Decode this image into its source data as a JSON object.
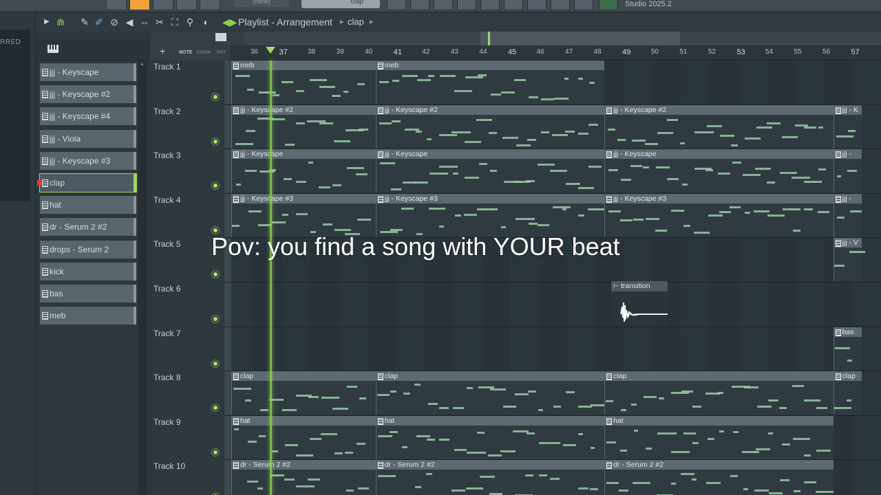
{
  "app": {
    "studio_label": "Studio 2025.2",
    "pattern_selector": "clap",
    "none_selector": "(none)",
    "sidebar_label": "RRED"
  },
  "playlist": {
    "title": "Playlist - Arrangement",
    "breadcrumb": "clap",
    "header_labels": [
      "NOTE",
      "CHAN",
      "PAT"
    ]
  },
  "patterns": [
    {
      "label": "jjj - Keyscape",
      "selected": false
    },
    {
      "label": "jjj - Keyscape #2",
      "selected": false
    },
    {
      "label": "jjj - Keyscape #4",
      "selected": false
    },
    {
      "label": "jjj - Viola",
      "selected": false
    },
    {
      "label": "jjj - Keyscape #3",
      "selected": false
    },
    {
      "label": "clap",
      "selected": true
    },
    {
      "label": "hat",
      "selected": false
    },
    {
      "label": "dr - Serum 2 #2",
      "selected": false
    },
    {
      "label": "drops - Serum 2",
      "selected": false
    },
    {
      "label": "kick",
      "selected": false
    },
    {
      "label": "bas",
      "selected": false
    },
    {
      "label": "meb",
      "selected": false
    }
  ],
  "ruler": [
    "36",
    "37",
    "38",
    "39",
    "40",
    "41",
    "42",
    "43",
    "44",
    "45",
    "46",
    "47",
    "48",
    "49",
    "50",
    "51",
    "52",
    "53",
    "54",
    "55",
    "56",
    "57"
  ],
  "tracks": [
    {
      "name": "Track 1",
      "clips": [
        {
          "label": "meb",
          "start": 36,
          "end": 41
        },
        {
          "label": "meb",
          "start": 41,
          "end": 49
        }
      ]
    },
    {
      "name": "Track 2",
      "clips": [
        {
          "label": "jjj - Keyscape #2",
          "start": 36,
          "end": 41
        },
        {
          "label": "jjj - Keyscape #2",
          "start": 41,
          "end": 49
        },
        {
          "label": "jjj - Keyscape #2",
          "start": 49,
          "end": 57
        },
        {
          "label": "jjj - K",
          "start": 57,
          "end": 58
        }
      ]
    },
    {
      "name": "Track 3",
      "clips": [
        {
          "label": "jjj - Keyscape",
          "start": 36,
          "end": 41
        },
        {
          "label": "jjj - Keyscape",
          "start": 41,
          "end": 49
        },
        {
          "label": "jjj - Keyscape",
          "start": 49,
          "end": 57
        },
        {
          "label": "jjj -",
          "start": 57,
          "end": 58
        }
      ]
    },
    {
      "name": "Track 4",
      "clips": [
        {
          "label": "jjj - Keyscape #3",
          "start": 36,
          "end": 41
        },
        {
          "label": "jjj - Keyscape #3",
          "start": 41,
          "end": 49
        },
        {
          "label": "jjj - Keyscape #3",
          "start": 49,
          "end": 57
        },
        {
          "label": "jjj -",
          "start": 57,
          "end": 58
        }
      ]
    },
    {
      "name": "Track 5",
      "clips": [
        {
          "label": "jjj - V",
          "start": 57,
          "end": 58
        }
      ]
    },
    {
      "name": "Track 6",
      "clips": []
    },
    {
      "name": "Track 7",
      "clips": [
        {
          "label": "bas",
          "start": 57,
          "end": 58
        }
      ]
    },
    {
      "name": "Track 8",
      "clips": [
        {
          "label": "clap",
          "start": 36,
          "end": 41
        },
        {
          "label": "clap",
          "start": 41,
          "end": 49
        },
        {
          "label": "clap",
          "start": 49,
          "end": 57
        },
        {
          "label": "clap",
          "start": 57,
          "end": 58
        }
      ]
    },
    {
      "name": "Track 9",
      "clips": [
        {
          "label": "hat",
          "start": 36,
          "end": 41
        },
        {
          "label": "hat",
          "start": 41,
          "end": 49
        },
        {
          "label": "hat",
          "start": 49,
          "end": 57
        }
      ]
    },
    {
      "name": "Track 10",
      "clips": [
        {
          "label": "dr - Serum 2 #2",
          "start": 36,
          "end": 41
        },
        {
          "label": "dr - Serum 2 #2",
          "start": 41,
          "end": 49
        },
        {
          "label": "dr - Serum 2 #2",
          "start": 49,
          "end": 57
        }
      ]
    }
  ],
  "transition_clip": {
    "label": "transition"
  },
  "caption": "Pov: you find a song with YOUR beat",
  "colors": {
    "accent": "#8ed14a",
    "note": "#98c9a5",
    "clip_header": "#5e6a71",
    "selected_pattern_outline": "#9fd86a"
  },
  "icons": [
    "play-icon",
    "magnet-icon",
    "pencil-icon",
    "paint-icon",
    "delete-icon",
    "mute-icon",
    "slip-icon",
    "slice-icon",
    "select-icon",
    "zoom-icon",
    "speaker-icon",
    "piano-icon"
  ]
}
